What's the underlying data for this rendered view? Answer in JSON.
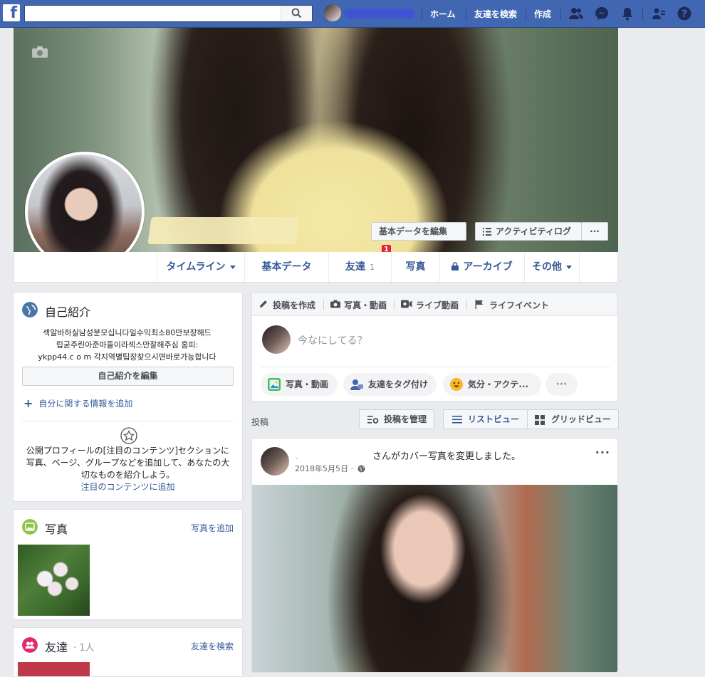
{
  "topbar": {
    "logo": "f",
    "search_placeholder": "",
    "nav": [
      "ホーム",
      "友達を検索",
      "作成"
    ]
  },
  "cover": {
    "edit_basic_label": "基本データを編集",
    "edit_basic_badge": "1",
    "activity_log_label": "アクティビティログ",
    "more_label": "···"
  },
  "tabs": {
    "timeline": "タイムライン",
    "about": "基本データ",
    "friends": "友達",
    "friends_count": "1",
    "photos": "写真",
    "archive": "アーカイブ",
    "more": "その他"
  },
  "intro": {
    "title": "自己紹介",
    "bio_line1": "섹알바하실남성분모십니다일수익최소80만보장해드",
    "bio_line2": "립굳주린아준마들이라섹스만잘해주심 홈피:",
    "bio_line3": "ykpp44.c o m 각지역별팁장찾으시면바로가능합니다",
    "edit_button": "自己紹介を編集",
    "add_info": "自分に関する情報を追加",
    "featured_text": "公開プロフィールの[注目のコンテンツ]セクションに写真、ページ、グループなどを追加して、あなたの大切なものを紹介しよう。",
    "featured_link": "注目のコンテンツに追加"
  },
  "photos_card": {
    "title": "写真",
    "add_link": "写真を追加"
  },
  "friends_card": {
    "title": "友達",
    "count": "· 1人",
    "find_link": "友達を検索"
  },
  "composer": {
    "tab_create": "投稿を作成",
    "tab_photo": "写真・動画",
    "tab_live": "ライブ動画",
    "tab_event": "ライフイベント",
    "placeholder": "今なにしてる？",
    "pill_photo": "写真・動画",
    "pill_tag": "友達をタグ付け",
    "pill_feeling": "気分・アクテ...",
    "pill_more": "···"
  },
  "posts_header": {
    "label": "投稿",
    "manage": "投稿を管理",
    "list_view": "リストビュー",
    "grid_view": "グリッドビュー"
  },
  "post": {
    "name_prefix": "、",
    "action_text": "さんがカバー写真を変更しました。",
    "date": "2018年5月5日 ·",
    "more": "···"
  },
  "colors": {
    "brand": "#4267b2",
    "link": "#365899",
    "badge": "#e41e3f"
  }
}
